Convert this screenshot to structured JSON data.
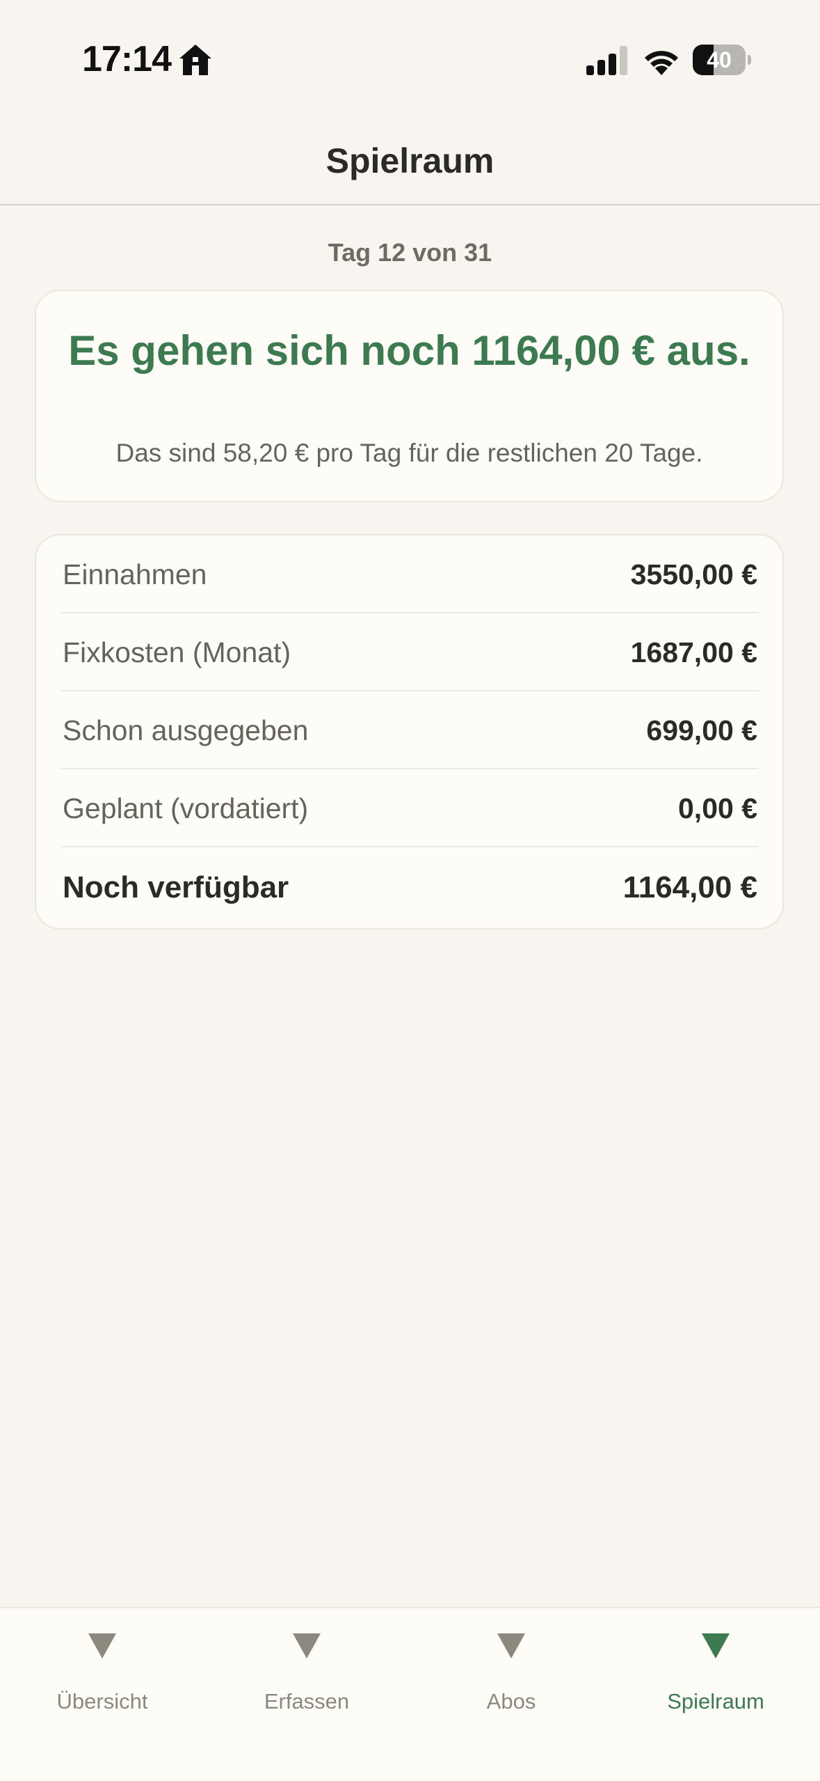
{
  "status_bar": {
    "time": "17:14",
    "battery_level": "40",
    "battery_fraction": 0.4,
    "signal_bars_active": 3,
    "signal_bars_total": 4
  },
  "nav": {
    "title": "Spielraum"
  },
  "period": {
    "label": "Tag 12 von 31"
  },
  "summary": {
    "headline": "Es gehen sich noch 1164,00 € aus.",
    "subline": "Das sind 58,20 € pro Tag für die restlichen 20 Tage."
  },
  "breakdown": {
    "rows": [
      {
        "label": "Einnahmen",
        "value": "3550,00 €"
      },
      {
        "label": "Fixkosten (Monat)",
        "value": "1687,00 €"
      },
      {
        "label": "Schon ausgegeben",
        "value": "699,00 €"
      },
      {
        "label": "Geplant (vordatiert)",
        "value": "0,00 €"
      },
      {
        "label": "Noch verfügbar",
        "value": "1164,00 €"
      }
    ]
  },
  "tabs": [
    {
      "label": "Übersicht",
      "icon": "triangle-down-icon",
      "active": false
    },
    {
      "label": "Erfassen",
      "icon": "triangle-down-icon",
      "active": false
    },
    {
      "label": "Abos",
      "icon": "triangle-down-icon",
      "active": false
    },
    {
      "label": "Spielraum",
      "icon": "triangle-down-icon",
      "active": true
    }
  ],
  "colors": {
    "accent": "#3c7a50",
    "background": "#f8f5f0",
    "card": "#fdfcf7",
    "inactive_tab": "#8c887d"
  }
}
